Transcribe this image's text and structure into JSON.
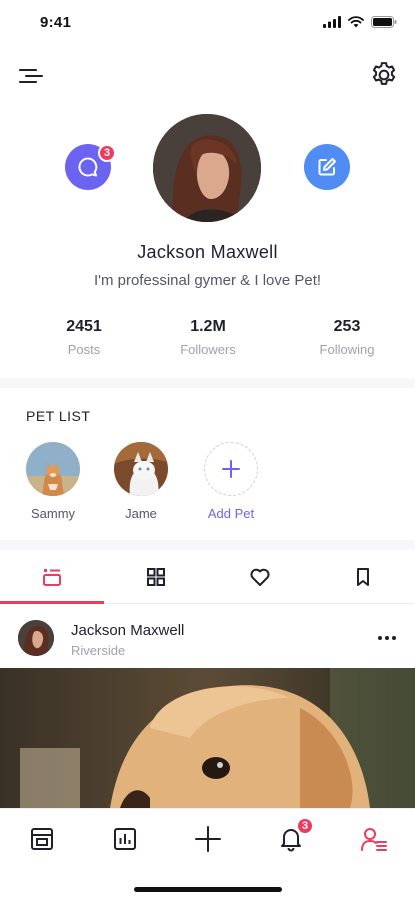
{
  "status_bar": {
    "time": "9:41"
  },
  "profile": {
    "name": "Jackson Maxwell",
    "bio": "I'm professinal gymer & I love Pet!",
    "chat_badge": "3",
    "stats": [
      {
        "value": "2451",
        "label": "Posts"
      },
      {
        "value": "1.2M",
        "label": "Followers"
      },
      {
        "value": "253",
        "label": "Following"
      }
    ]
  },
  "pet_list": {
    "title": "PET LIST",
    "pets": [
      {
        "name": "Sammy"
      },
      {
        "name": "Jame"
      }
    ],
    "add_label": "Add Pet"
  },
  "tabs": [
    {
      "icon": "list-icon",
      "active": true
    },
    {
      "icon": "grid-icon",
      "active": false
    },
    {
      "icon": "heart-icon",
      "active": false
    },
    {
      "icon": "bookmark-icon",
      "active": false
    }
  ],
  "post": {
    "author": "Jackson Maxwell",
    "location": "Riverside"
  },
  "bottom_nav": {
    "items": [
      "home-icon",
      "stats-icon",
      "plus-icon",
      "bell-icon",
      "profile-icon"
    ],
    "notification_badge": "3"
  },
  "colors": {
    "accent": "#ef3a5d",
    "purple": "#6c64f0",
    "blue": "#4f8cf3"
  }
}
